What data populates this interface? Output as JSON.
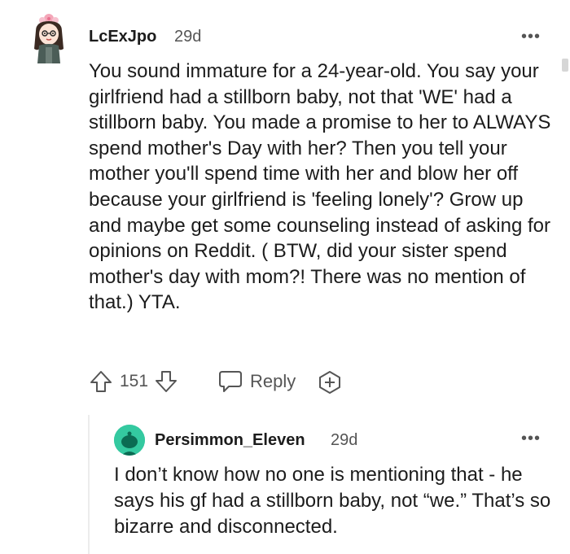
{
  "comment": {
    "username": "LcExJpo",
    "age": "29d",
    "more_label": "•••",
    "body": "You sound immature for a 24-year-old. You say your girlfriend had a stillborn baby, not that 'WE' had a stillborn baby. You made a promise to her to ALWAYS spend mother's Day with her? Then you tell your mother you'll spend time with her and blow her off because your girlfriend is 'feeling lonely'? Grow up and maybe get some counseling instead of asking for opinions on Reddit. ( BTW, did your sister spend mother's day with mom?! There was no mention of that.) YTA.",
    "vote_count": "151",
    "reply_label": "Reply",
    "icons": [
      "upvote-icon",
      "downvote-icon",
      "reply-icon",
      "award-icon",
      "more-icon"
    ]
  },
  "reply": {
    "username": "Persimmon_Eleven",
    "age": "29d",
    "more_label": "•••",
    "body": "I don’t know how no one is mentioning that - he says his gf had a stillborn baby, not “we.” That’s so bizarre and disconnected.",
    "avatar_color": "#34c9a0"
  }
}
